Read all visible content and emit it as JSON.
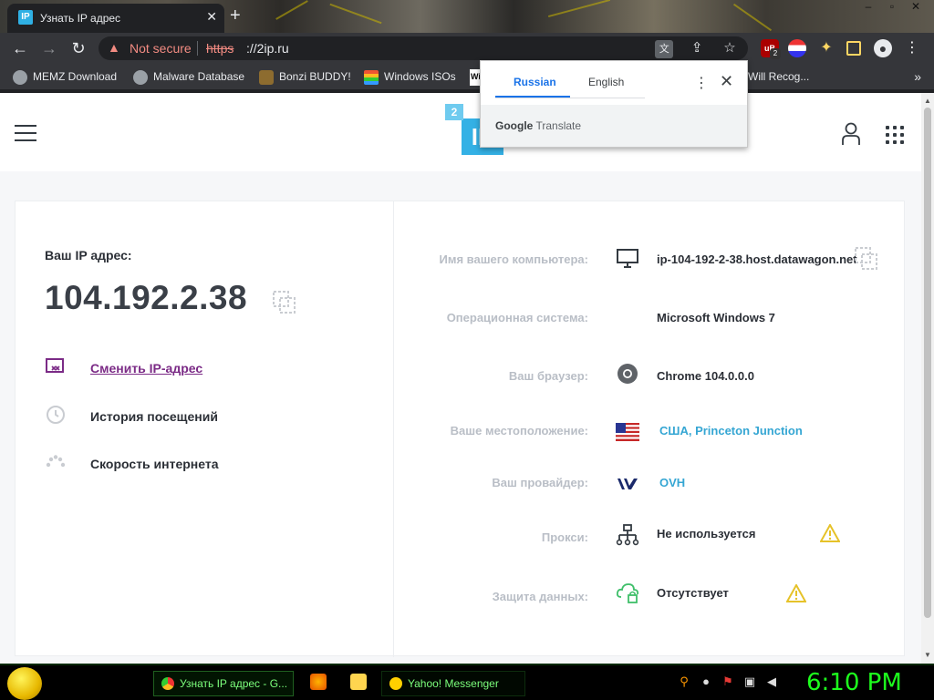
{
  "browser": {
    "tab_title": "Узнать IP адрес",
    "tab_favicon_text": "IP",
    "address": {
      "security": "Not secure",
      "scheme": "https",
      "host": "://2ip.ru"
    },
    "bookmarks": [
      {
        "label": "MEMZ Download",
        "icon": "globe-icon"
      },
      {
        "label": "Malware Database",
        "icon": "globe-icon"
      },
      {
        "label": "Bonzi BUDDY!",
        "icon": "bonzi-icon"
      },
      {
        "label": "Windows ISOs",
        "icon": "windows-flag-icon"
      },
      {
        "label": "Wi",
        "icon": "wikipedia-icon"
      },
      {
        "label": "Will Recog...",
        "icon": "blank-icon"
      }
    ],
    "ext_badge": "2"
  },
  "translate": {
    "tabs": [
      "Russian",
      "English"
    ],
    "selected": "Russian",
    "brand_google": "Google",
    "brand_translate": "Translate"
  },
  "site": {
    "logo_big": "IP",
    "logo_small": "2",
    "ip_label": "Ваш IP адрес:",
    "ip_value": "104.192.2.38",
    "links": [
      {
        "label": "Сменить IP-адрес",
        "icon": "change-ip-icon"
      },
      {
        "label": "История посещений",
        "icon": "history-icon"
      },
      {
        "label": "Скорость интернета",
        "icon": "speed-icon"
      }
    ],
    "rows": [
      {
        "label": "Имя вашего компьютера:",
        "value": "ip-104-192-2-38.host.datawagon.net",
        "icon": "monitor-icon",
        "is_link": false
      },
      {
        "label": "Операционная система:",
        "value": "Microsoft Windows 7",
        "icon": "",
        "is_link": false
      },
      {
        "label": "Ваш браузер:",
        "value": "Chrome 104.0.0.0",
        "icon": "chrome-icon",
        "is_link": false
      },
      {
        "label": "Ваше местоположение:",
        "value": "США, Princeton Junction",
        "icon": "us-flag-icon",
        "is_link": true
      },
      {
        "label": "Ваш провайдер:",
        "value": "OVH",
        "icon": "ovh-icon",
        "is_link": true
      },
      {
        "label": "Прокси:",
        "value": "Не используется",
        "icon": "network-icon",
        "is_link": false,
        "warning": true
      },
      {
        "label": "Защита данных:",
        "value": "Отсутствует",
        "icon": "cloud-lock-icon",
        "is_link": false,
        "warning": true
      }
    ]
  },
  "taskbar": {
    "tasks": [
      {
        "label": "Узнать IP адрес - G...",
        "icon": "chrome-icon"
      },
      {
        "label": "Yahoo! Messenger",
        "icon": "yahoo-smiley-icon"
      }
    ],
    "clock": "6:10 PM"
  },
  "colors": {
    "accent_link": "#35a6d3",
    "active_link": "#7b2b86",
    "clock": "#1dff1d",
    "logo_blue": "#34b1e5"
  }
}
